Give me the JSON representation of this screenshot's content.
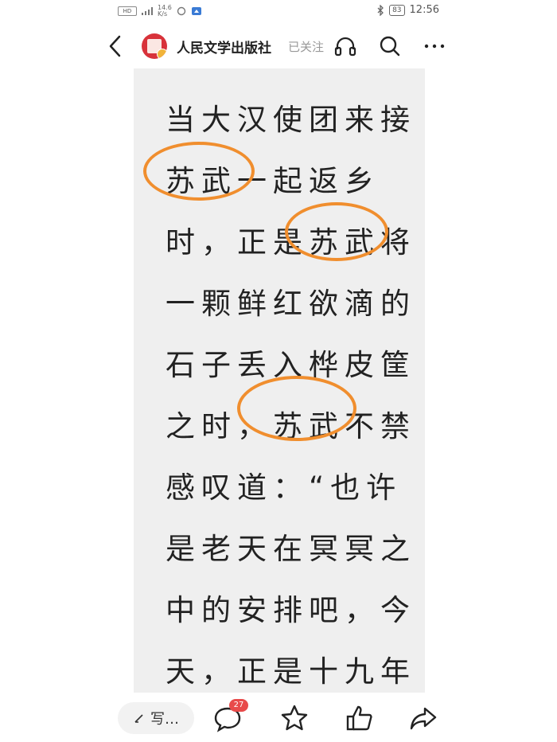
{
  "status_bar": {
    "network": "HD",
    "speed_value": "14.6",
    "speed_unit": "K/s",
    "battery": "83",
    "time": "12:56"
  },
  "header": {
    "publisher_name": "人民文学出版社",
    "follow_status": "已关注"
  },
  "article": {
    "lines": [
      "当大汉使团来接",
      "苏武一起返乡",
      "时，正是苏武将",
      "一颗鲜红欲滴的",
      "石子丢入桦皮筐",
      "之时，苏武不禁",
      "感叹道：“也许",
      "是老天在冥冥之",
      "中的安排吧，今",
      "天，正是十九年"
    ],
    "highlight_color": "#f08e2e"
  },
  "bottom_bar": {
    "comment_placeholder": "写…",
    "comment_count": "27"
  },
  "colors": {
    "article_bg": "#efefef",
    "accent_red": "#d8323a",
    "badge_red": "#e84a4a"
  }
}
